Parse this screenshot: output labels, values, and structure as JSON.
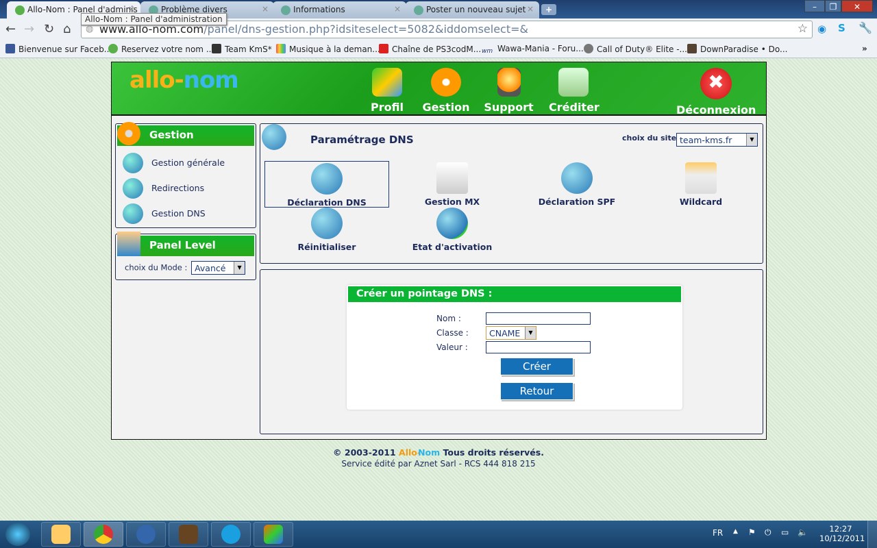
{
  "browser": {
    "tabs": [
      {
        "title": "Allo-Nom : Panel d'adminis",
        "active": true
      },
      {
        "title": "Problème divers"
      },
      {
        "title": "Informations"
      },
      {
        "title": "Poster un nouveau sujet"
      }
    ],
    "new_tab": "+",
    "tooltip": "Allo-Nom : Panel d'administration",
    "url_host": "www.allo-nom.com",
    "url_path": "/panel/dns-gestion.php?idsiteselect=5082&iddomselect=&",
    "bookmarks": [
      "Bienvenue sur Faceb...",
      "Reservez votre nom ...",
      "Team KmS*",
      "Musique à la deman...",
      "Chaîne de PS3codM...",
      "Wawa-Mania - Foru...",
      "Call of Duty® Elite -...",
      "DownParadise • Do..."
    ],
    "overflow": "»"
  },
  "site": {
    "logo": {
      "part1": "allo-",
      "part2": "nom"
    },
    "nav": [
      "Profil",
      "Gestion",
      "Support",
      "Créditer",
      "Déconnexion"
    ],
    "sidebar": {
      "gestion_title": "Gestion",
      "items": [
        "Gestion générale",
        "Redirections",
        "Gestion DNS"
      ],
      "panel_level_title": "Panel Level",
      "mode_label": "choix du Mode :",
      "mode_value": "Avancé"
    },
    "main": {
      "title": "Paramétrage DNS",
      "site_label": "choix du site :",
      "site_value": "team-kms.fr",
      "tools": [
        "Déclaration DNS",
        "Gestion MX",
        "Déclaration SPF",
        "Wildcard",
        "Réinitialiser",
        "Etat d'activation"
      ],
      "selected_tool": "Déclaration DNS"
    },
    "form": {
      "title": "Créer un pointage DNS :",
      "nom_label": "Nom :",
      "nom_value": "",
      "classe_label": "Classe :",
      "classe_value": "CNAME",
      "valeur_label": "Valeur :",
      "valeur_value": "",
      "create": "Créer",
      "back": "Retour"
    },
    "footer": {
      "copyright": "© 2003-2011",
      "brand1": "Allo-",
      "brand2": "Nom",
      "rights": "Tous droits réservés.",
      "line2": "Service édité par Aznet Sarl - RCS 444 818 215"
    }
  },
  "taskbar": {
    "lang": "FR",
    "time": "12:27",
    "date": "10/12/2011"
  },
  "colors": {
    "green": "#1aa52a",
    "navy": "#1c2a5a",
    "button": "#1670b8",
    "orange": "#f39c12",
    "cyan": "#2ab4e8"
  }
}
